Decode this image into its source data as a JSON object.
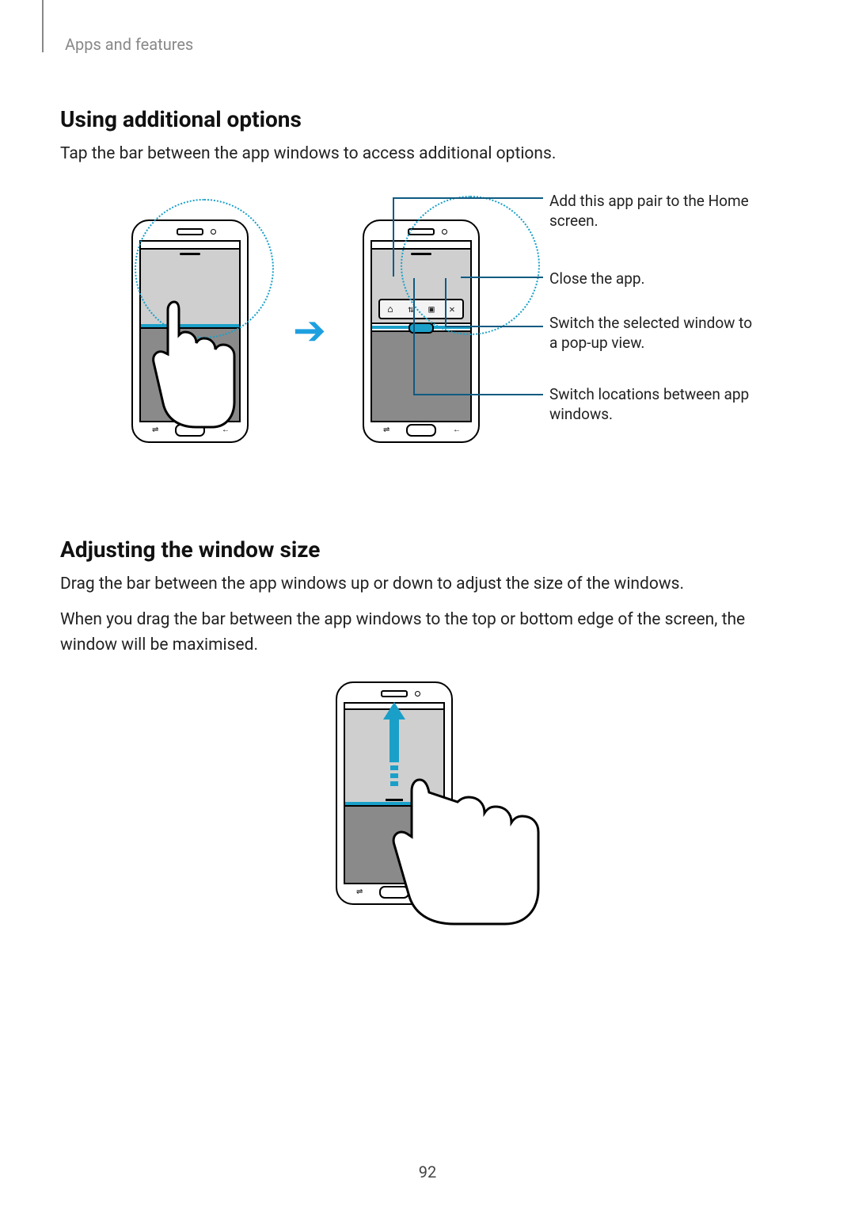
{
  "breadcrumb": "Apps and features",
  "section1": {
    "heading": "Using additional options",
    "body": "Tap the bar between the app windows to access additional options."
  },
  "callouts": {
    "add_pair": "Add this app pair to the Home screen.",
    "close_app": "Close the app.",
    "popup": "Switch the selected window to a pop-up view.",
    "switch_loc": "Switch locations between app windows."
  },
  "toolbar_icons": {
    "home": "⌂",
    "switch": "⇅",
    "popup": "▣",
    "close": "✕"
  },
  "section2": {
    "heading": "Adjusting the window size",
    "body1": "Drag the bar between the app windows up or down to adjust the size of the windows.",
    "body2": "When you drag the bar between the app windows to the top or bottom edge of the screen, the window will be maximised."
  },
  "page_number": "92"
}
